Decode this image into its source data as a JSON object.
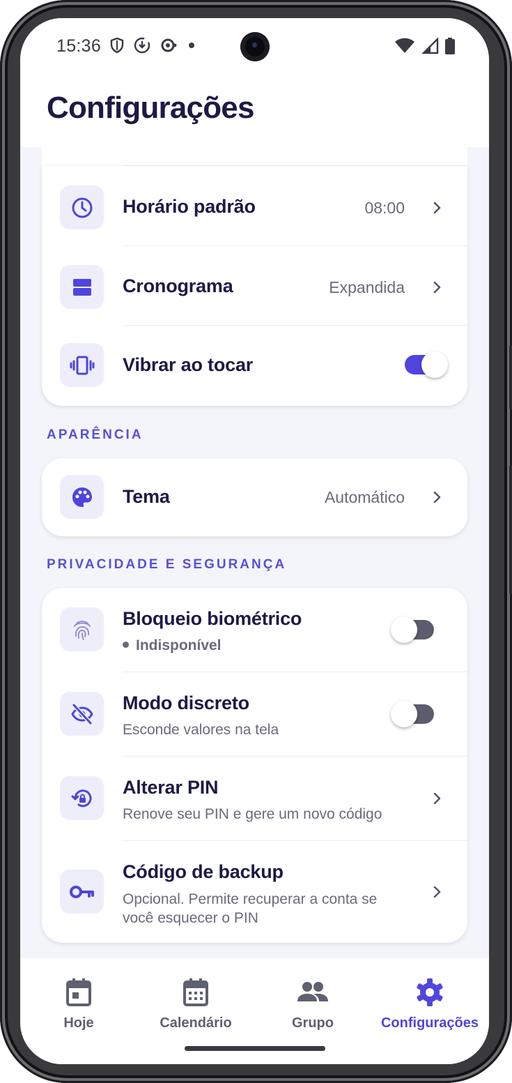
{
  "status_bar": {
    "time": "15:36",
    "left_icons": [
      "shield-icon",
      "download-icon",
      "sync-icon",
      "dot-icon"
    ],
    "right_icons": [
      "wifi-icon",
      "signal-icon",
      "battery-icon"
    ]
  },
  "header": {
    "title": "Configurações"
  },
  "general": {
    "items": [
      {
        "title": "Horário padrão",
        "value": "08:00",
        "icon": "clock-icon"
      },
      {
        "title": "Cronograma",
        "value": "Expandida",
        "icon": "view-agenda-icon"
      },
      {
        "title": "Vibrar ao tocar",
        "toggle": true,
        "icon": "vibration-icon"
      }
    ]
  },
  "appearance": {
    "label": "APARÊNCIA",
    "items": [
      {
        "title": "Tema",
        "value": "Automático",
        "icon": "palette-icon"
      }
    ]
  },
  "privacy": {
    "label": "PRIVACIDADE E SEGURANÇA",
    "items": [
      {
        "title": "Bloqueio biométrico",
        "subtitle": "Indisponível",
        "toggle": false,
        "icon": "fingerprint-icon"
      },
      {
        "title": "Modo discreto",
        "subtitle": "Esconde valores na tela",
        "toggle": false,
        "icon": "eye-off-icon"
      },
      {
        "title": "Alterar PIN",
        "subtitle": "Renove seu PIN e gere um novo código",
        "icon": "lock-reset-icon"
      },
      {
        "title": "Código de backup",
        "subtitle_line1": "Opcional. Permite recuperar a conta se",
        "subtitle_line2": "você esquecer o PIN",
        "icon": "key-icon"
      }
    ]
  },
  "bottom_nav": {
    "items": [
      {
        "label": "Hoje",
        "icon": "calendar-today-icon",
        "active": false
      },
      {
        "label": "Calendário",
        "icon": "calendar-month-icon",
        "active": false
      },
      {
        "label": "Grupo",
        "icon": "group-icon",
        "active": false
      },
      {
        "label": "Configurações",
        "icon": "gear-icon",
        "active": true
      }
    ]
  },
  "colors": {
    "accent": "#4f45dd",
    "title": "#1c1a46",
    "secondary_text": "#6b6b7d",
    "icon_bg": "#eeeefb",
    "background": "#f4f5fa"
  }
}
